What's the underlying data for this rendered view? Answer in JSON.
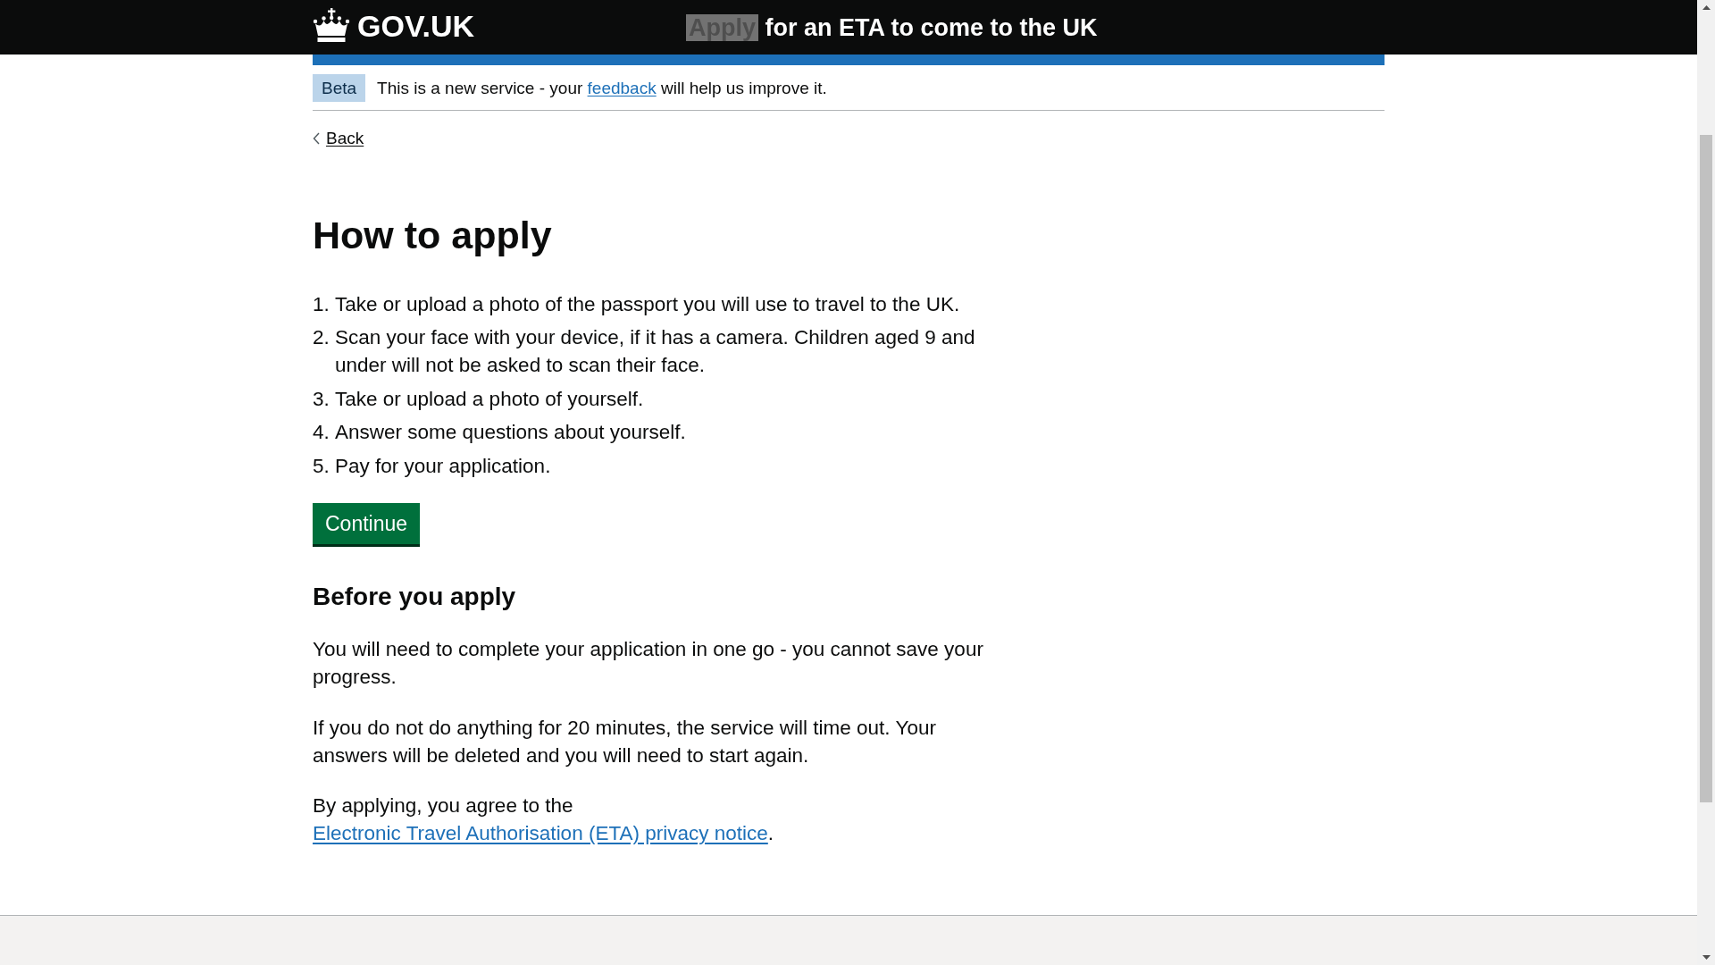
{
  "header": {
    "logo_text": "GOV.UK",
    "service_name": [
      {
        "text": "Apply",
        "highlighted": true
      },
      {
        "text": " for an ETA to come to the UK",
        "highlighted": false
      }
    ]
  },
  "phase_banner": {
    "tag": "Beta",
    "parts": [
      {
        "kind": "text",
        "text": "This is a new service - your "
      },
      {
        "kind": "link",
        "text": "feedback"
      },
      {
        "kind": "text",
        "text": " will help us improve it."
      }
    ]
  },
  "back_link": "Back",
  "title": "How to apply",
  "steps": [
    {
      "number": "1.",
      "text": "Take or upload a photo of the passport you will use to travel to the UK."
    },
    {
      "number": "2.",
      "text": "Scan your face with your device, if it has a camera. Children aged 9 and under will not be asked to scan their face."
    },
    {
      "number": "3.",
      "text": "Take or upload a photo of yourself."
    },
    {
      "number": "4.",
      "text": "Answer some questions about yourself."
    },
    {
      "number": "5.",
      "text": "Pay for your application."
    }
  ],
  "continue_button": "Continue",
  "before_you_apply": {
    "heading": "Before you apply",
    "paragraphs": [
      {
        "parts": [
          {
            "kind": "text",
            "text": "You will need to complete your application in one go - you cannot save your progress."
          }
        ]
      },
      {
        "parts": [
          {
            "kind": "text",
            "text": "If you do not do anything for 20 minutes, the service will time out. Your answers will be deleted and you will need to start again."
          }
        ]
      },
      {
        "parts": [
          {
            "kind": "text",
            "text": "By applying, you agree to the "
          },
          {
            "kind": "link",
            "text": "Electronic Travel Authorisation (ETA) privacy notice"
          },
          {
            "kind": "text",
            "text": "."
          }
        ]
      }
    ]
  }
}
